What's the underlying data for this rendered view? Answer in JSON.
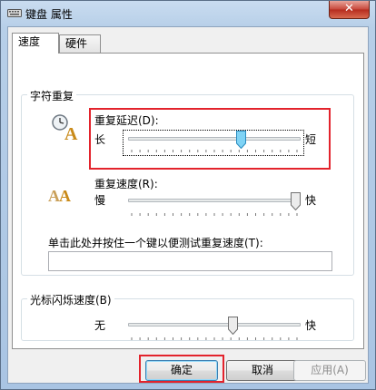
{
  "window": {
    "title": "键盘 属性",
    "close_glyph": "✕",
    "icon": "keyboard-icon"
  },
  "tabs": [
    {
      "label": "速度",
      "active": true
    },
    {
      "label": "硬件",
      "active": false
    }
  ],
  "repeat_group": {
    "title": "字符重复",
    "delay": {
      "label": "重复延迟(D):",
      "min_label": "长",
      "max_label": "短",
      "value_fraction": 0.667,
      "icon": "repeat-delay-icon"
    },
    "rate": {
      "label": "重复速度(R):",
      "min_label": "慢",
      "max_label": "快",
      "value_fraction": 1.0,
      "icon": "repeat-rate-icon"
    },
    "test_label": "单击此处并按住一个键以便测试重复速度(T):",
    "test_value": ""
  },
  "cursor_group": {
    "title": "光标闪烁速度(B)",
    "min_label": "无",
    "max_label": "快",
    "value_fraction": 0.615
  },
  "buttons": {
    "ok": "确定",
    "cancel": "取消",
    "apply": "应用(A)"
  },
  "colors": {
    "highlight": "#e3232c",
    "slider_thumb_focus": "#4cb8e6"
  }
}
